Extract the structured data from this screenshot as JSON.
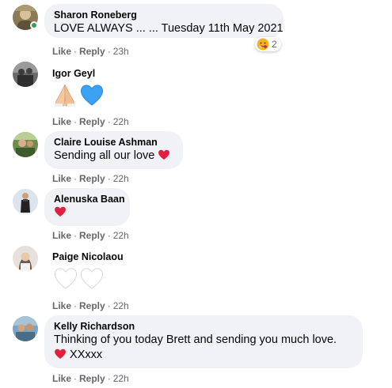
{
  "comments": [
    {
      "author": "Sharon Roneberg",
      "text": "LOVE ALWAYS ... ... Tuesday 11th May 2021",
      "reaction_count": "2",
      "like": "Like",
      "reply": "Reply",
      "time": "23h",
      "avatar_colors": [
        "#8a7a55",
        "#c9b68a"
      ]
    },
    {
      "author": "Igor Geyl",
      "emoji": "🙏💙",
      "like": "Like",
      "reply": "Reply",
      "time": "22h",
      "avatar_colors": [
        "#555555",
        "#9a9a9a"
      ]
    },
    {
      "author": "Claire Louise Ashman",
      "text": "Sending all our love",
      "like": "Like",
      "reply": "Reply",
      "time": "22h",
      "avatar_colors": [
        "#4e6b3a",
        "#9bb27a"
      ]
    },
    {
      "author": "Alenuska Baan",
      "like": "Like",
      "reply": "Reply",
      "time": "22h",
      "avatar_colors": [
        "#cfd8e3",
        "#2d2d2d"
      ]
    },
    {
      "author": "Paige Nicolaou",
      "emoji": "🤍🤍",
      "like": "Like",
      "reply": "Reply",
      "time": "22h",
      "avatar_colors": [
        "#d9d4cf",
        "#6b5a4e"
      ]
    },
    {
      "author": "Kelly Richardson",
      "text": "Thinking of you today Brett and sending you much love.",
      "text2": "XXxxx",
      "like": "Like",
      "reply": "Reply",
      "time": "22h",
      "avatar_colors": [
        "#5a7d96",
        "#c8a27a"
      ]
    }
  ],
  "colors": {
    "bubble": "#f0f2f5",
    "meta": "#65676b",
    "heart": "#e41e3f",
    "online": "#31a24c"
  },
  "icons": {
    "heart": "red-heart-icon",
    "reaction": "hug-reaction-icon"
  }
}
